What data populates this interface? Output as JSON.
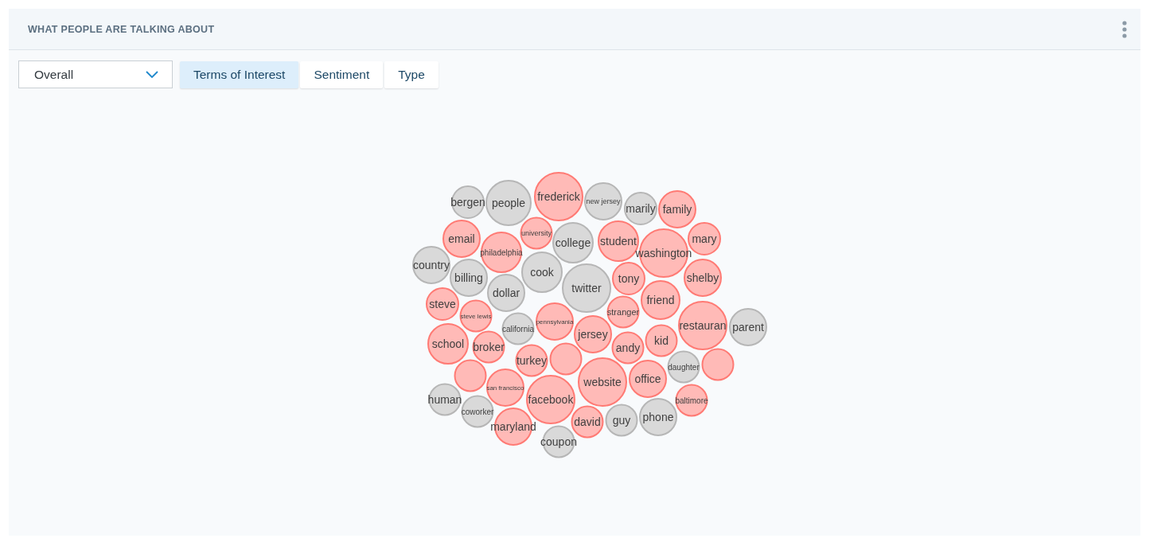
{
  "panel": {
    "title": "WHAT PEOPLE ARE TALKING ABOUT"
  },
  "filter": {
    "value": "Overall"
  },
  "tabs": [
    {
      "label": "Terms of Interest",
      "selected": true
    },
    {
      "label": "Sentiment",
      "selected": false
    },
    {
      "label": "Type",
      "selected": false
    }
  ],
  "bubbles": [
    {
      "label": "bergen",
      "color": "#d9d9d9"
    },
    {
      "label": "people",
      "color": "#d9d9d9"
    },
    {
      "label": "frederick",
      "color": "#ffbab7"
    },
    {
      "label": "new jersey",
      "color": "#d9d9d9"
    },
    {
      "label": "marily",
      "color": "#d9d9d9"
    },
    {
      "label": "family",
      "color": "#ffbab7"
    },
    {
      "label": "email",
      "color": "#ffbab7"
    },
    {
      "label": "philadelphia",
      "color": "#ffbab7"
    },
    {
      "label": "university",
      "color": "#ffbab7"
    },
    {
      "label": "college",
      "color": "#d9d9d9"
    },
    {
      "label": "student",
      "color": "#ffbab7"
    },
    {
      "label": "washington",
      "color": "#ffbab7"
    },
    {
      "label": "mary",
      "color": "#ffbab7"
    },
    {
      "label": "country",
      "color": "#d9d9d9"
    },
    {
      "label": "billing",
      "color": "#d9d9d9"
    },
    {
      "label": "dollar",
      "color": "#d9d9d9"
    },
    {
      "label": "cook",
      "color": "#d9d9d9"
    },
    {
      "label": "twitter",
      "color": "#d9d9d9"
    },
    {
      "label": "tony",
      "color": "#ffbab7"
    },
    {
      "label": "shelby",
      "color": "#ffbab7"
    },
    {
      "label": "steve",
      "color": "#ffbab7"
    },
    {
      "label": "steve lewis",
      "color": "#ffbab7"
    },
    {
      "label": "stranger",
      "color": "#ffbab7"
    },
    {
      "label": "friend",
      "color": "#ffbab7"
    },
    {
      "label": "california",
      "color": "#d9d9d9"
    },
    {
      "label": "pennsylvania",
      "color": "#ffbab7"
    },
    {
      "label": "jersey",
      "color": "#ffbab7"
    },
    {
      "label": "restauran",
      "color": "#ffbab7"
    },
    {
      "label": "parent",
      "color": "#d9d9d9"
    },
    {
      "label": "school",
      "color": "#ffbab7"
    },
    {
      "label": "broker",
      "color": "#ffbab7"
    },
    {
      "label": "andy",
      "color": "#ffbab7"
    },
    {
      "label": "kid",
      "color": "#ffbab7"
    },
    {
      "label": "turkey",
      "color": "#ffbab7"
    },
    {
      "color": "#ffbab7"
    },
    {
      "label": "daughter",
      "color": "#d9d9d9"
    },
    {
      "color": "#ffbab7"
    },
    {
      "color": "#ffbab7"
    },
    {
      "label": "san francisco",
      "color": "#ffbab7"
    },
    {
      "label": "website",
      "color": "#ffbab7"
    },
    {
      "label": "office",
      "color": "#ffbab7"
    },
    {
      "label": "human",
      "color": "#d9d9d9"
    },
    {
      "label": "facebook",
      "color": "#ffbab7"
    },
    {
      "label": "baltimore",
      "color": "#ffbab7"
    },
    {
      "label": "coworker",
      "color": "#d9d9d9"
    },
    {
      "label": "maryland",
      "color": "#ffbab7"
    },
    {
      "label": "david",
      "color": "#ffbab7"
    },
    {
      "label": "guy",
      "color": "#d9d9d9"
    },
    {
      "label": "phone",
      "color": "#d9d9d9"
    },
    {
      "label": "coupon",
      "color": "#d9d9d9"
    }
  ]
}
